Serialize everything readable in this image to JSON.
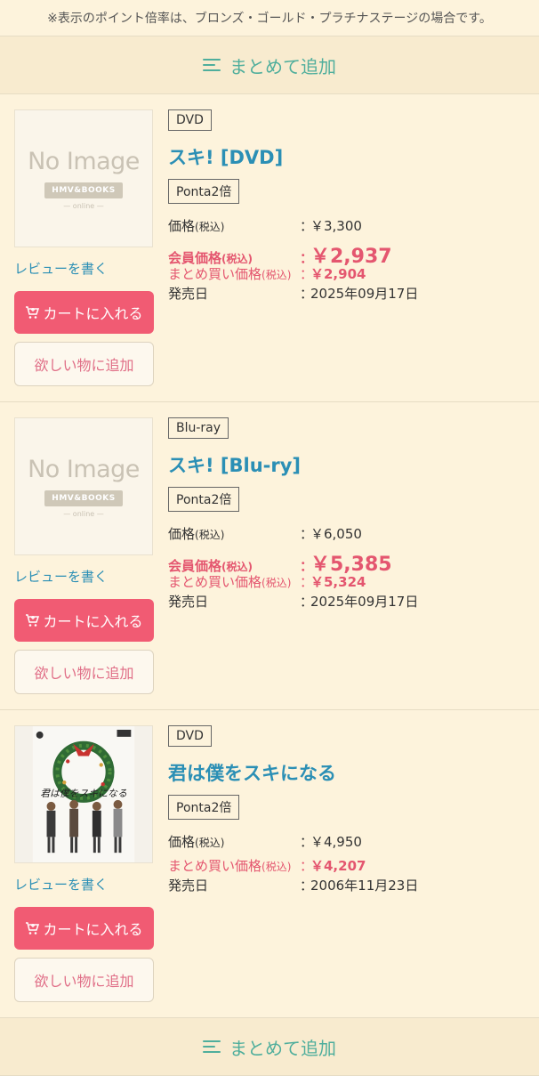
{
  "notice": "※表示のポイント倍率は、ブロンズ・ゴールド・プラチナステージの場合です。",
  "bulk_add_label": "まとめて追加",
  "labels": {
    "review": "レビューを書く",
    "cart": "カートに入れる",
    "wishlist": "欲しい物に追加",
    "price": "価格",
    "tax": "(税込)",
    "member_price": "会員価格",
    "bulk_price": "まとめ買い価格",
    "release": "発売日",
    "colon": "："
  },
  "no_image": {
    "text": "No Image",
    "logo": "HMV&BOOKS",
    "online": "— online —"
  },
  "products": [
    {
      "format": "DVD",
      "title": "スキ! [DVD]",
      "ponta": "Ponta2倍",
      "price": "￥3,300",
      "member_price": "￥2,937",
      "bulk_price": "￥2,904",
      "release_date": "2025年09月17日"
    },
    {
      "format": "Blu-ray",
      "title": "スキ! [Blu-ry]",
      "ponta": "Ponta2倍",
      "price": "￥6,050",
      "member_price": "￥5,385",
      "bulk_price": "￥5,324",
      "release_date": "2025年09月17日"
    },
    {
      "format": "DVD",
      "title": "君は僕をスキになる",
      "ponta": "Ponta2倍",
      "price": "￥4,950",
      "bulk_price": "￥4,207",
      "release_date": "2006年11月23日",
      "cover_text": "君は僕をスキになる"
    }
  ]
}
